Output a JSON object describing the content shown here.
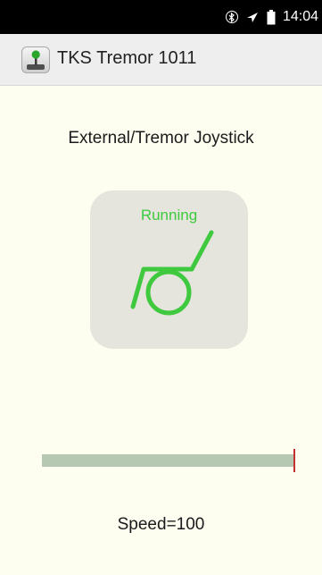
{
  "status_bar": {
    "time": "14:04",
    "icons": [
      "bluetooth-icon",
      "airplane-icon",
      "battery-icon"
    ]
  },
  "app_bar": {
    "title": "TKS Tremor 1011",
    "icon": "joystick-app-icon"
  },
  "main": {
    "heading": "External/Tremor Joystick",
    "joystick": {
      "status": "Running",
      "icon": "wheelchair-icon",
      "status_color": "#3ec93e"
    },
    "speed_slider": {
      "value": 100,
      "max": 100
    },
    "speed_label": "Speed=100"
  },
  "colors": {
    "background": "#fdfdf0",
    "action_bar": "#eeeeee",
    "accent_green": "#3ec93e",
    "slider_track": "#b7c8b2",
    "slider_thumb": "#c23030"
  }
}
